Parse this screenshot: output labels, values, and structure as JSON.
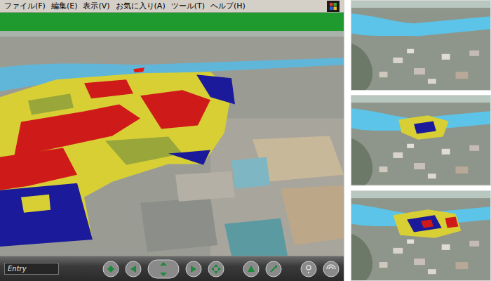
{
  "menu": [
    {
      "label": "ファイル(F)"
    },
    {
      "label": "編集(E)"
    },
    {
      "label": "表示(V)"
    },
    {
      "label": "お気に入り(A)"
    },
    {
      "label": "ツール(T)"
    },
    {
      "label": "ヘルプ(H)"
    }
  ],
  "viewpoint": {
    "value": "Entry"
  },
  "thumbnails": [
    {
      "kind": "none"
    },
    {
      "kind": "partial"
    },
    {
      "kind": "full"
    }
  ]
}
